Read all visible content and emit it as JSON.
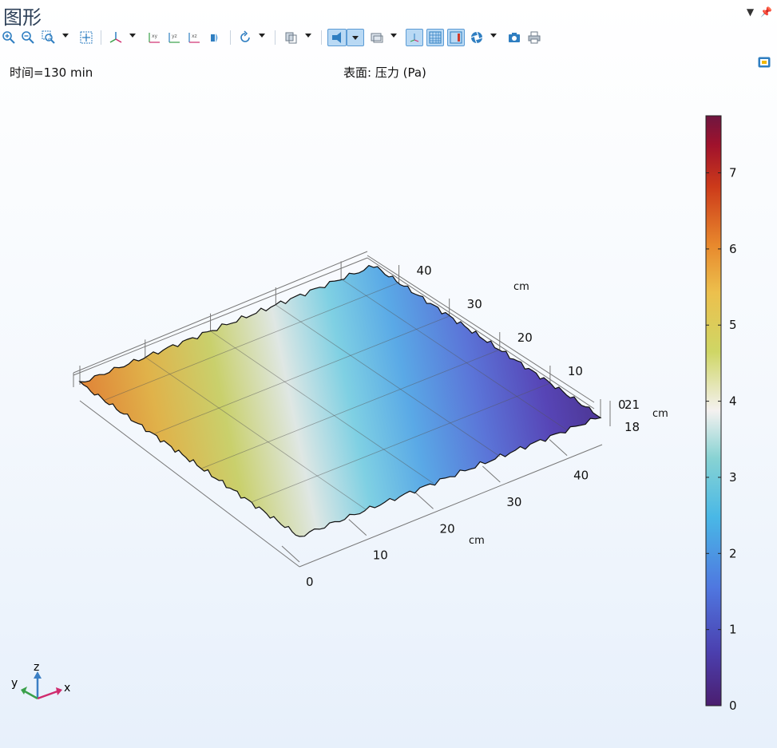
{
  "window": {
    "title": "图形"
  },
  "toolbar": {
    "buttons": [
      {
        "name": "zoom-in-icon"
      },
      {
        "name": "zoom-out-icon"
      },
      {
        "name": "zoom-box-icon"
      },
      {
        "name": "zoom-extents-icon"
      },
      {
        "name": "axis-orientation-icon"
      },
      {
        "name": "xy-view-icon",
        "text": "xy"
      },
      {
        "name": "yz-view-icon",
        "text": "yz"
      },
      {
        "name": "xz-view-icon",
        "text": "xz"
      },
      {
        "name": "light-icon"
      },
      {
        "name": "rotate-icon"
      },
      {
        "name": "transparency-icon"
      },
      {
        "name": "scene-light-icon"
      },
      {
        "name": "view-select-icon"
      },
      {
        "name": "show-grid-icon"
      },
      {
        "name": "show-axis-icon"
      },
      {
        "name": "show-legend-icon"
      },
      {
        "name": "aperture-icon"
      },
      {
        "name": "camera-icon"
      },
      {
        "name": "print-icon"
      }
    ]
  },
  "plot": {
    "time_label": "时间=130 min",
    "surface_label": "表面: 压力 (Pa)"
  },
  "chart_data": {
    "type": "heatmap",
    "title": "表面: 压力 (Pa)",
    "subtitle": "时间=130 min",
    "x_axis": {
      "unit": "cm",
      "ticks": [
        "0",
        "10",
        "20",
        "30",
        "40"
      ],
      "range": [
        0,
        45
      ]
    },
    "y_axis": {
      "unit": "cm",
      "ticks": [
        "0",
        "10",
        "20",
        "30",
        "40"
      ],
      "range": [
        0,
        45
      ]
    },
    "z_axis": {
      "unit": "cm",
      "ticks": [
        "18",
        "21"
      ]
    },
    "colorbar": {
      "ticks": [
        "0",
        "1",
        "2",
        "3",
        "4",
        "5",
        "6",
        "7"
      ],
      "range": [
        0,
        7.75
      ],
      "colors": [
        "#4b1e6f",
        "#4b3fae",
        "#4f77e0",
        "#49b8e6",
        "#88d3d3",
        "#f4f1f0",
        "#cfd665",
        "#ecc04d",
        "#e8892d",
        "#cc3a1a",
        "#a0122c",
        "#6f1640"
      ]
    },
    "pressure_range_on_surface": [
      0.8,
      6.5
    ],
    "grid": true
  },
  "triad": {
    "z": "z",
    "y": "y",
    "x": "x"
  }
}
